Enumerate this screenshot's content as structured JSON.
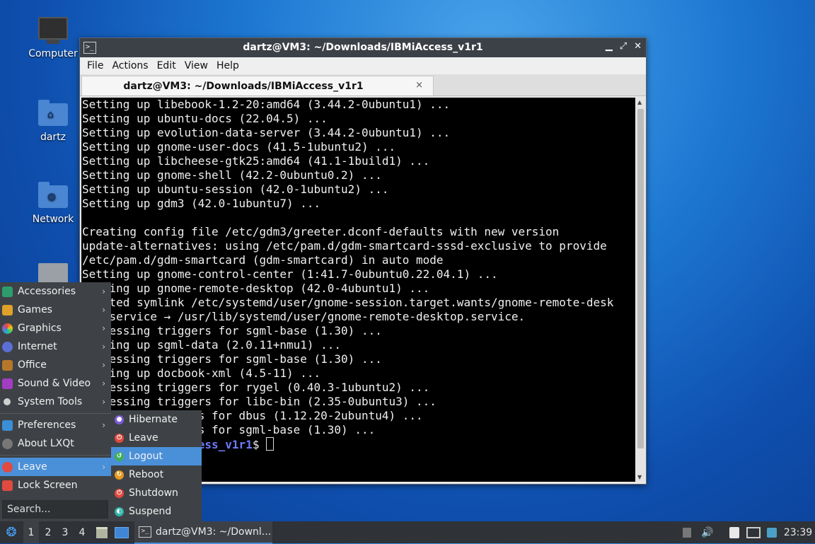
{
  "desktop": {
    "icons": [
      {
        "label": "Computer"
      },
      {
        "label": "dartz"
      },
      {
        "label": "Network"
      }
    ]
  },
  "window": {
    "title": "dartz@VM3: ~/Downloads/IBMiAccess_v1r1",
    "menu": [
      "File",
      "Actions",
      "Edit",
      "View",
      "Help"
    ],
    "tab_title": "dartz@VM3: ~/Downloads/IBMiAccess_v1r1",
    "tab_close": "×",
    "terminal_lines": [
      "Setting up libebook-1.2-20:amd64 (3.44.2-0ubuntu1) ...",
      "Setting up ubuntu-docs (22.04.5) ...",
      "Setting up evolution-data-server (3.44.2-0ubuntu1) ...",
      "Setting up gnome-user-docs (41.5-1ubuntu2) ...",
      "Setting up libcheese-gtk25:amd64 (41.1-1build1) ...",
      "Setting up gnome-shell (42.2-0ubuntu0.2) ...",
      "Setting up ubuntu-session (42.0-1ubuntu2) ...",
      "Setting up gdm3 (42.0-1ubuntu7) ...",
      "",
      "Creating config file /etc/gdm3/greeter.dconf-defaults with new version",
      "update-alternatives: using /etc/pam.d/gdm-smartcard-sssd-exclusive to provide",
      "/etc/pam.d/gdm-smartcard (gdm-smartcard) in auto mode",
      "Setting up gnome-control-center (1:41.7-0ubuntu0.22.04.1) ...",
      "    ing up gnome-remote-desktop (42.0-4ubuntu1) ...",
      "    ted symlink /etc/systemd/user/gnome-session.target.wants/gnome-remote-desk",
      "    service → /usr/lib/systemd/user/gnome-remote-desktop.service.",
      "    essing triggers for sgml-base (1.30) ...",
      "    ing up sgml-data (2.0.11+nmu1) ...",
      "    essing triggers for sgml-base (1.30) ...",
      "    ing up docbook-xml (4.5-11) ...",
      "    essing triggers for rygel (0.40.3-1ubuntu2) ...",
      "    essing triggers for libc-bin (2.35-0ubuntu3) ...",
      "    ssing triggers for dbus (1.12.20-2ubuntu4) ...",
      "    ssing triggers for sgml-base (1.30) ..."
    ],
    "prompt_tail": "loads/IBMiAccess_v1r1",
    "prompt_symbol": "$ "
  },
  "start_menu": {
    "items": [
      {
        "label": "Accessories",
        "arrow": "›"
      },
      {
        "label": "Games",
        "arrow": "›"
      },
      {
        "label": "Graphics",
        "arrow": "›"
      },
      {
        "label": "Internet",
        "arrow": "›"
      },
      {
        "label": "Office",
        "arrow": "›"
      },
      {
        "label": "Sound & Video",
        "arrow": "›"
      },
      {
        "label": "System Tools",
        "arrow": "›"
      },
      {
        "label": "Preferences",
        "arrow": "›"
      },
      {
        "label": "About LXQt",
        "arrow": ""
      },
      {
        "label": "Leave",
        "arrow": "›"
      },
      {
        "label": "Lock Screen",
        "arrow": ""
      }
    ],
    "search_placeholder": "Search..."
  },
  "leave_submenu": {
    "items": [
      "Hibernate",
      "Leave",
      "Logout",
      "Reboot",
      "Shutdown",
      "Suspend"
    ],
    "active": "Logout"
  },
  "taskbar": {
    "workspaces": [
      "1",
      "2",
      "3",
      "4"
    ],
    "window_button": "dartz@VM3: ~/Downl...",
    "clock": "23:39"
  },
  "colors": {
    "accent": "#4a90d9",
    "terminal_bg": "#000000",
    "prompt": "#6f7bff"
  }
}
